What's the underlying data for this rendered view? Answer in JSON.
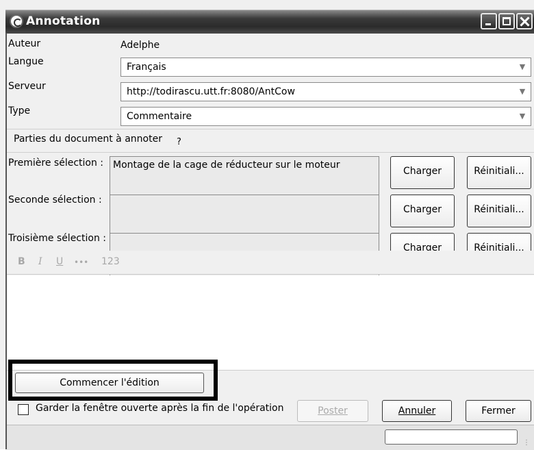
{
  "window": {
    "title": "Annotation",
    "icons": {
      "app": "annotation-app-icon",
      "minimize": "minimize-icon",
      "maximize": "maximize-icon",
      "close": "close-icon"
    }
  },
  "form": {
    "author_label": "Auteur",
    "author_value": "Adelphe",
    "language_label": "Langue",
    "language_value": "Français",
    "server_label": "Serveur",
    "server_value": "http://todirascu.utt.fr:8080/AntCow",
    "type_label": "Type",
    "type_value": "Commentaire"
  },
  "parts": {
    "heading": "Parties du document à annoter",
    "help": "?",
    "selections": [
      {
        "label": "Première sélection :",
        "value": "Montage de la cage de réducteur sur le moteur",
        "load": "Charger",
        "reset": "Réinitiali..."
      },
      {
        "label": "Seconde sélection :",
        "value": "",
        "load": "Charger",
        "reset": "Réinitiali..."
      },
      {
        "label": "Troisième sélection :",
        "value": "",
        "load": "Charger",
        "reset": "Réinitiali..."
      }
    ]
  },
  "toolbar": {
    "bold": "B",
    "italic": "I",
    "underline": "U",
    "dots": "•••",
    "numbers": "123"
  },
  "actions": {
    "start_edit": "Commencer l'édition",
    "keep_open": "Garder la fenêtre ouverte après la fin de l'opération",
    "post": "Poster",
    "cancel": "Annuler",
    "close": "Fermer"
  },
  "colors": {
    "titlebar": "#2b2b2b",
    "highlight": "#000000"
  }
}
